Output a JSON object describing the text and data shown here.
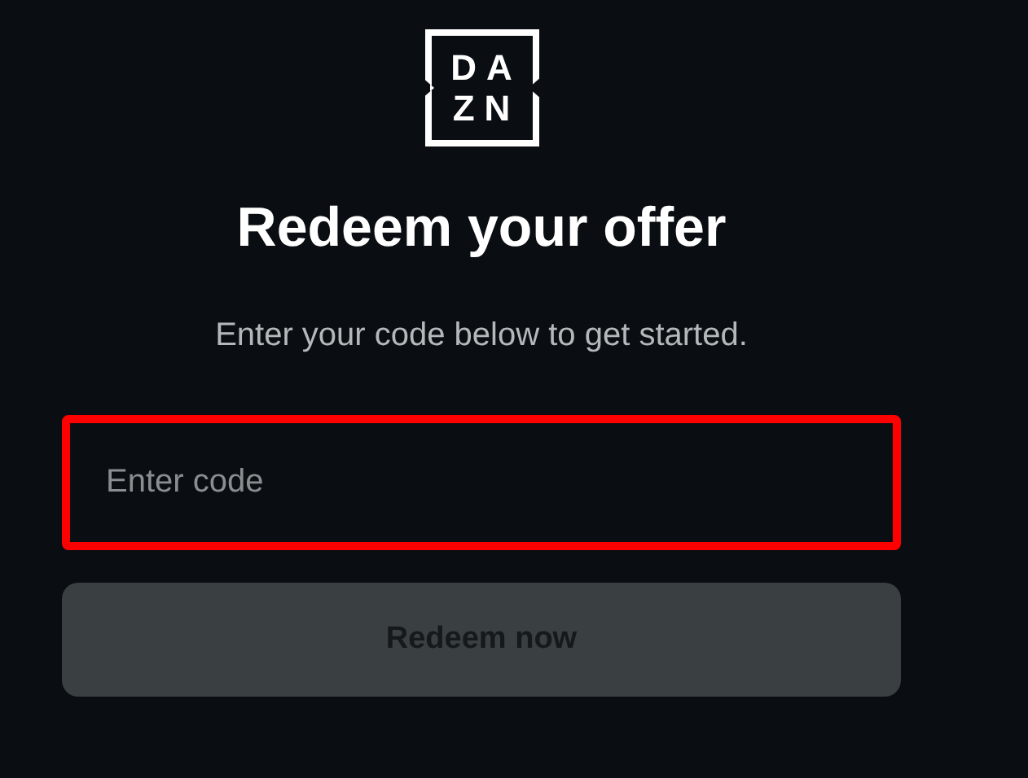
{
  "logo": {
    "lines": [
      "DA",
      "ZN"
    ]
  },
  "title": "Redeem your offer",
  "subtitle": "Enter your code below to get started.",
  "code_field": {
    "placeholder": "Enter code",
    "highlighted": true
  },
  "submit_button": {
    "label": "Redeem now",
    "disabled": true
  }
}
